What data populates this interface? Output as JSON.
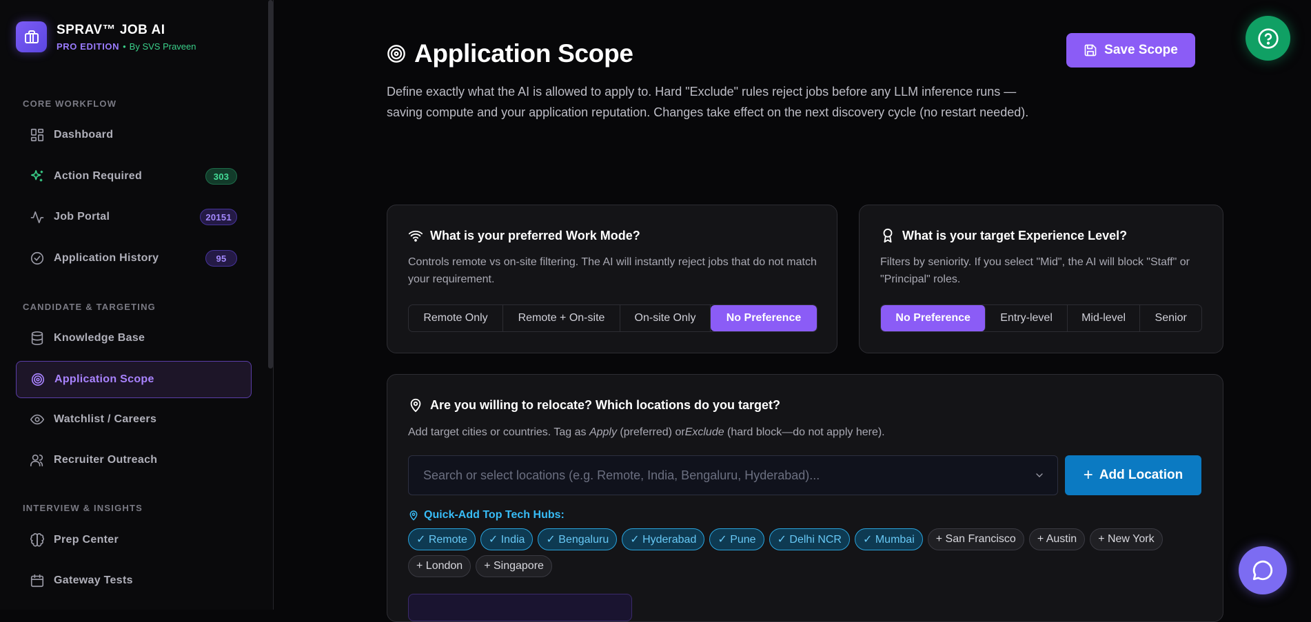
{
  "brand": {
    "title": "SPRAV™ JOB AI",
    "edition": "PRO EDITION",
    "separator": "•",
    "byline": "By SVS Praveen"
  },
  "sidebar": {
    "sections": [
      {
        "title": "CORE WORKFLOW"
      },
      {
        "title": "CANDIDATE & TARGETING"
      },
      {
        "title": "INTERVIEW & INSIGHTS"
      }
    ],
    "items": [
      {
        "label": "Dashboard",
        "icon": "dashboard-grid-icon"
      },
      {
        "label": "Action Required",
        "icon": "sparkles-icon",
        "badge": "303"
      },
      {
        "label": "Job Portal",
        "icon": "activity-pulse-icon",
        "badge": "20151"
      },
      {
        "label": "Application History",
        "icon": "check-circle-icon",
        "badge": "95"
      },
      {
        "label": "Knowledge Base",
        "icon": "database-icon"
      },
      {
        "label": "Application Scope",
        "icon": "target-icon",
        "active": true
      },
      {
        "label": "Watchlist / Careers",
        "icon": "eye-icon"
      },
      {
        "label": "Recruiter Outreach",
        "icon": "users-icon"
      },
      {
        "label": "Prep Center",
        "icon": "brain-icon"
      },
      {
        "label": "Gateway Tests",
        "icon": "calendar-icon"
      }
    ]
  },
  "header": {
    "title": "Application Scope",
    "description": "Define exactly what the AI is allowed to apply to. Hard \"Exclude\" rules reject jobs before any LLM inference runs — saving compute and your application reputation. Changes take effect on the next discovery cycle (no restart needed).",
    "save_label": "Save Scope"
  },
  "work_mode": {
    "title": "What is your preferred Work Mode?",
    "description": "Controls remote vs on-site filtering. The AI will instantly reject jobs that do not match your requirement.",
    "options": [
      "Remote Only",
      "Remote + On-site",
      "On-site Only",
      "No Preference"
    ],
    "selected": "No Preference"
  },
  "experience": {
    "title": "What is your target Experience Level?",
    "description": "Filters by seniority. If you select \"Mid\", the AI will block \"Staff\" or \"Principal\" roles.",
    "options": [
      "No Preference",
      "Entry-level",
      "Mid-level",
      "Senior"
    ],
    "selected": "No Preference"
  },
  "locations": {
    "title": "Are you willing to relocate? Which locations do you target?",
    "desc_prefix": "Add target cities or countries. Tag as ",
    "desc_apply": "Apply",
    "desc_mid": " (preferred) or",
    "desc_exclude": "Exclude",
    "desc_suffix": " (hard block—do not apply here).",
    "search_placeholder": "Search or select locations (e.g. Remote, India, Bengaluru, Hyderabad)...",
    "add_label": "Add Location",
    "add_symbol": "+",
    "quick_add_title": "Quick-Add Top Tech Hubs:",
    "selected_hubs": [
      "✓ Remote",
      "✓ India",
      "✓ Bengaluru",
      "✓ Hyderabad",
      "✓ Pune",
      "✓ Delhi NCR",
      "✓ Mumbai"
    ],
    "other_hubs": [
      "+ San Francisco",
      "+ Austin",
      "+ New York",
      "+ London",
      "+ Singapore"
    ]
  },
  "colors": {
    "accent": "#8b5cf6",
    "info": "#38bdf8",
    "success": "#10a064",
    "background": "#070709"
  }
}
